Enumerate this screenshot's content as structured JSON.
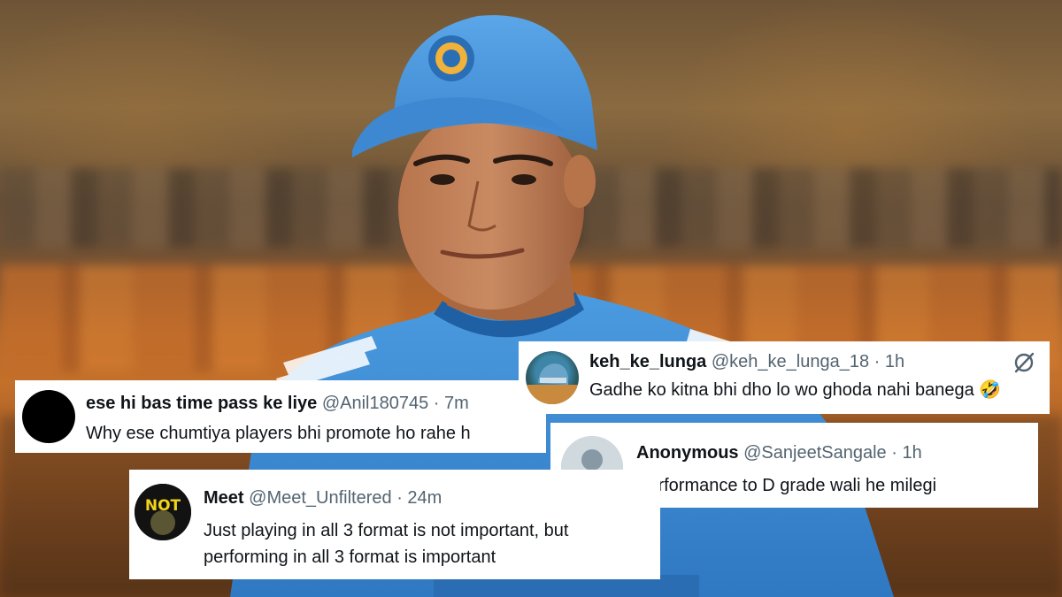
{
  "tweets": [
    {
      "id": "anil",
      "name": "ese hi bas time pass ke liye",
      "handle": "@Anil180745",
      "separator": "·",
      "time": "7m",
      "text": "Why ese chumtiya players bhi promote ho rahe h",
      "avatar_icon": "black-circle-avatar-icon"
    },
    {
      "id": "keh",
      "name": "keh_ke_lunga",
      "handle": "@keh_ke_lunga_18",
      "separator": "·",
      "time": "1h",
      "text": "Gadhe ko kitna bhi dho lo wo ghoda nahi banega 🤣",
      "avatar_icon": "helmet-avatar-icon",
      "extra_icon": "grok-icon"
    },
    {
      "id": "anon",
      "name": "Anonymous",
      "handle": "@SanjeetSangale",
      "separator": "·",
      "time": "1h",
      "text": "Performance to D grade wali he milegi",
      "avatar_icon": "default-user-avatar-icon"
    },
    {
      "id": "meet",
      "name": "Meet",
      "handle": "@Meet_Unfiltered",
      "separator": "·",
      "time": "24m",
      "text": "Just playing in all 3 format is not important, but performing in all 3 format is important",
      "avatar_icon": "not-logo-avatar-icon",
      "avatar_logo_text": "NOT"
    }
  ],
  "colors": {
    "text_primary": "#0f1419",
    "text_secondary": "#536471",
    "jersey_blue": "#3f8fd6",
    "cap_blue": "#4a9ae0"
  }
}
